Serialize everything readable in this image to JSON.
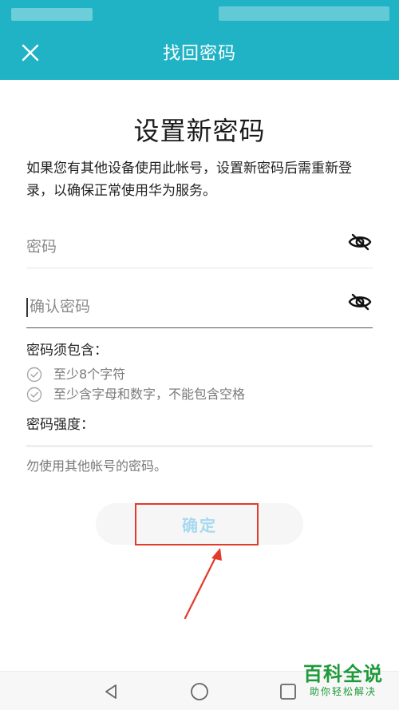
{
  "app_bar": {
    "title": "找回密码"
  },
  "heading": "设置新密码",
  "description": "如果您有其他设备使用此帐号，设置新密码后需重新登录，以确保正常使用华为服务。",
  "password_field": {
    "placeholder": "密码"
  },
  "confirm_field": {
    "placeholder": "确认密码"
  },
  "requirements": {
    "title": "密码须包含：",
    "items": [
      {
        "label": "至少8个字符"
      },
      {
        "label": "至少含字母和数字，不能包含空格"
      }
    ]
  },
  "strength": {
    "label": "密码强度："
  },
  "hint": "勿使用其他帐号的密码。",
  "confirm_button": {
    "label": "确定"
  },
  "watermark": {
    "title": "百科全说",
    "subtitle": "助你轻松解决"
  },
  "icons": {
    "close": "close-icon",
    "eye": "eye-off-icon",
    "check": "check-circle-icon",
    "back": "back-triangle-icon",
    "home": "home-circle-icon",
    "recent": "recent-square-icon"
  },
  "colors": {
    "primary": "#1fb3c5",
    "button_text": "#a7d9f0",
    "button_bg": "#f6f6f6",
    "annotation": "#e23a2b",
    "watermark": "#1e9a3a"
  }
}
